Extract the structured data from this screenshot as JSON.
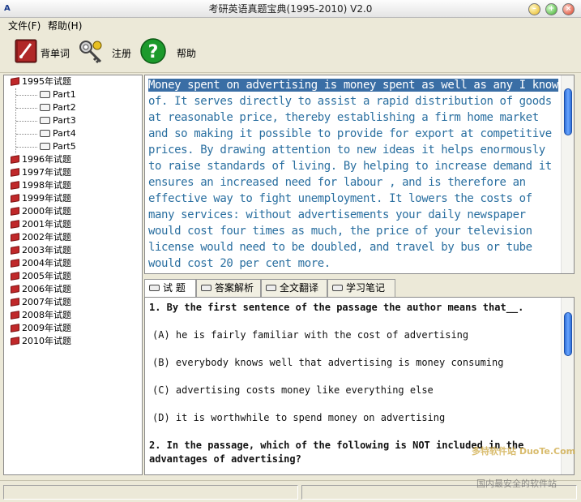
{
  "window": {
    "title": "考研英语真题宝典(1995-2010) V2.0",
    "app_icon": "A"
  },
  "menu": [
    {
      "label": "文件(F)"
    },
    {
      "label": "帮助(H)"
    }
  ],
  "toolbar": {
    "vocab_label": "背单词",
    "register_label": "注册",
    "help_label": "帮助"
  },
  "tree": {
    "years": [
      "1995年试题",
      "1996年试题",
      "1997年试题",
      "1998年试题",
      "1999年试题",
      "2000年试题",
      "2001年试题",
      "2002年试题",
      "2003年试题",
      "2004年试题",
      "2005年试题",
      "2006年试题",
      "2007年试题",
      "2008年试题",
      "2009年试题",
      "2010年试题"
    ],
    "parts_1995": [
      "Part1",
      "Part2",
      "Part3",
      "Part4",
      "Part5"
    ]
  },
  "passage": {
    "lines": [
      [
        "Money spent on advertising is money spent as well as any I know",
        true
      ],
      "of. It serves directly to assist a rapid distribution of goods",
      "at reasonable price, thereby establishing a firm home market",
      "and so making it possible to provide for export at competitive",
      "prices. By drawing attention to new ideas it helps enormously",
      "to raise standards of living. By helping to increase demand it",
      "ensures an increased need for labour , and is therefore an",
      "effective way to fight unemployment. It lowers the costs of",
      "many services: without advertisements your daily newspaper",
      "would cost four times as much, the price of your television",
      "license would need to be doubled, and travel by bus or tube",
      "would cost 20 per cent more."
    ]
  },
  "tabs": [
    {
      "label": "试 题",
      "active": true
    },
    {
      "label": "答案解析"
    },
    {
      "label": "全文翻译"
    },
    {
      "label": "学习笔记"
    }
  ],
  "questions": {
    "q1": "1. By the first sentence of the passage the author means that__.",
    "q1_a": "(A) he is fairly familiar with the cost of advertising",
    "q1_b": "(B) everybody knows well that advertising is money consuming",
    "q1_c": "(C) advertising costs money like everything else",
    "q1_d": "(D) it is worthwhile to spend money on advertising",
    "q2": "2. In the passage, which of the following is NOT included in the advantages of advertising?"
  },
  "watermark": {
    "brand": "多特软件站",
    "site": "DuoTe.Com",
    "slogan": "国内最安全的软件站"
  }
}
